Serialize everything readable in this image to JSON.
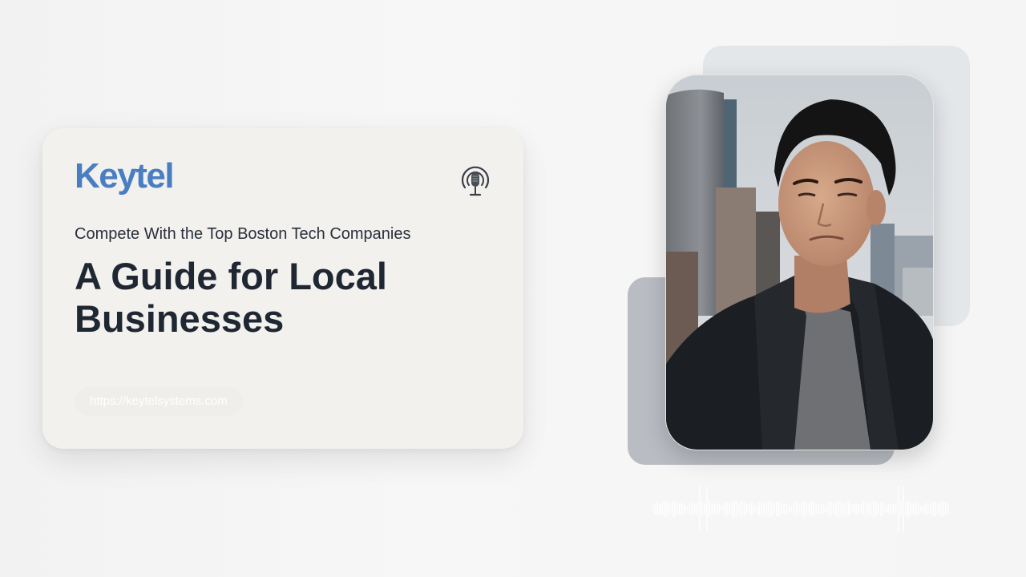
{
  "card": {
    "logo": "Keytel",
    "subtitle": "Compete With the Top Boston Tech Companies",
    "headline": "A Guide for Local Businesses",
    "url": "https://keytelsystems.com"
  },
  "icons": {
    "podcast": "podcast-microphone-icon"
  },
  "colors": {
    "background": "#f4f4f4",
    "card": "#f2f1ee",
    "logo_blue": "#4a7ec3",
    "headline": "#1f2733",
    "deco_light": "#e4e7ea",
    "deco_dark": "#b9bdc3"
  }
}
